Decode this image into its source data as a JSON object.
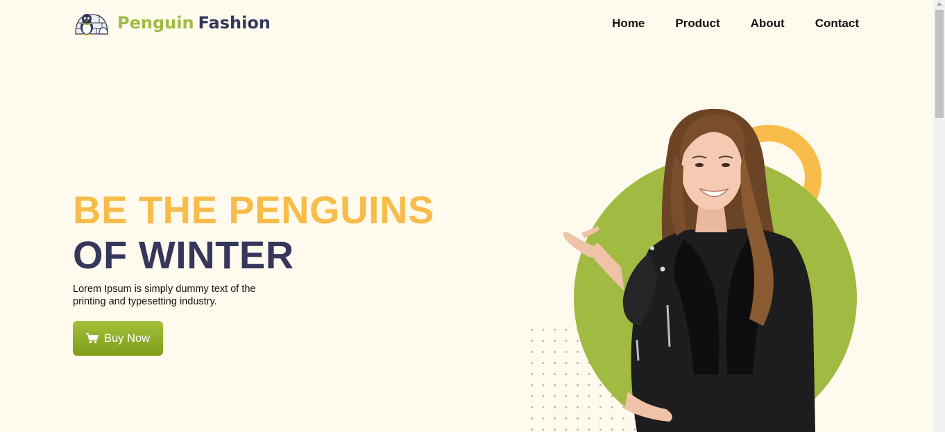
{
  "header": {
    "brand_part1": "Penguin",
    "brand_part2": "Fashion",
    "logo_icon": "penguin-igloo-logo"
  },
  "nav": {
    "items": [
      {
        "label": "Home"
      },
      {
        "label": "Product"
      },
      {
        "label": "About"
      },
      {
        "label": "Contact"
      }
    ]
  },
  "hero": {
    "headline_line1": "BE THE PENGUINS",
    "headline_line2": "OF WINTER",
    "description": "Lorem Ipsum is simply dummy text of the printing and typesetting industry.",
    "cta_label": "Buy Now",
    "cta_icon": "cart-icon",
    "image_alt": "smiling woman in black leather jacket"
  },
  "colors": {
    "background": "#fffaee",
    "accent_yellow": "#f8bc4a",
    "accent_green": "#a1ba42",
    "navy": "#35375a"
  }
}
